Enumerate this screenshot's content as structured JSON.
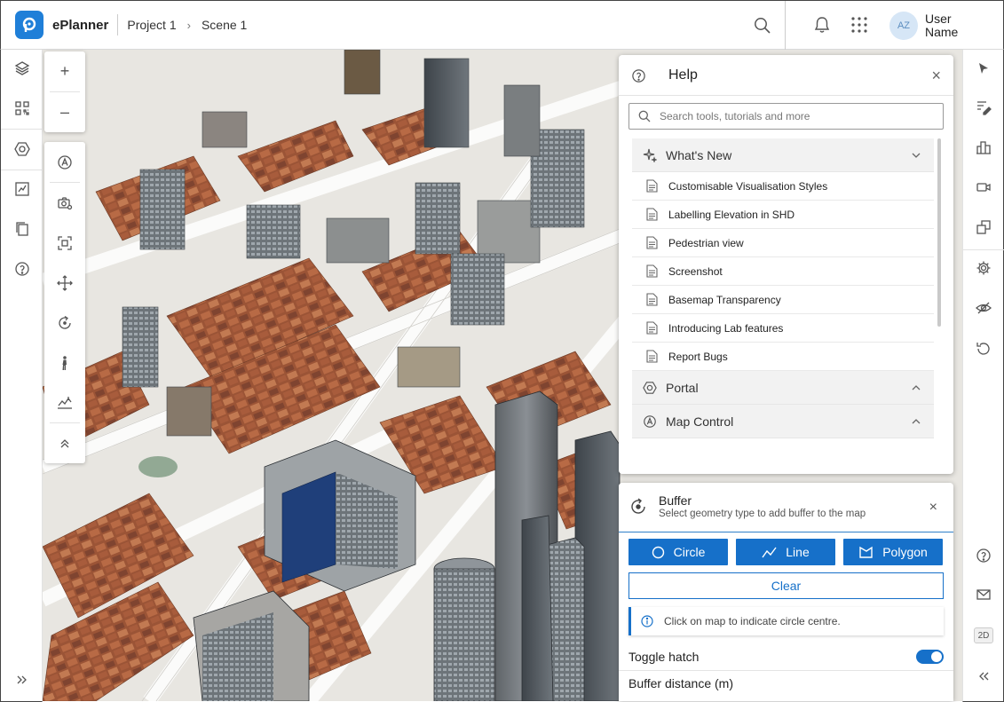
{
  "header": {
    "app_name": "ePlanner",
    "breadcrumb": [
      "Project 1",
      "Scene 1"
    ],
    "avatar_initials": "AZ",
    "user_name": "User Name"
  },
  "left_rail": {
    "icons": [
      "layers-icon",
      "qr-grid-icon",
      "portal-icon",
      "analysis-chart-icon",
      "copy-pages-icon",
      "help-circle-icon",
      "expand-double-chevron-icon"
    ]
  },
  "map_tools": {
    "zoom_in": "+",
    "zoom_out": "–"
  },
  "help_panel": {
    "title": "Help",
    "search_placeholder": "Search tools, tutorials and more",
    "whats_new": {
      "label": "What's New",
      "items": [
        "Customisable Visualisation Styles",
        "Labelling Elevation in SHD",
        "Pedestrian view",
        "Screenshot",
        "Basemap Transparency",
        "Introducing Lab features",
        "Report Bugs"
      ]
    },
    "portal_label": "Portal",
    "map_control_label": "Map Control"
  },
  "buffer_panel": {
    "title": "Buffer",
    "subtitle": "Select geometry type to add buffer to the map",
    "buttons": {
      "circle": "Circle",
      "line": "Line",
      "polygon": "Polygon",
      "clear": "Clear"
    },
    "info": "Click on map to indicate circle centre.",
    "toggle_hatch_label": "Toggle hatch",
    "toggle_hatch_on": true,
    "buffer_distance_label": "Buffer distance (m)"
  },
  "right_rail": {
    "badge_2d": "2D"
  },
  "colors": {
    "accent": "#1670c9",
    "logo": "#1f7fd8"
  }
}
